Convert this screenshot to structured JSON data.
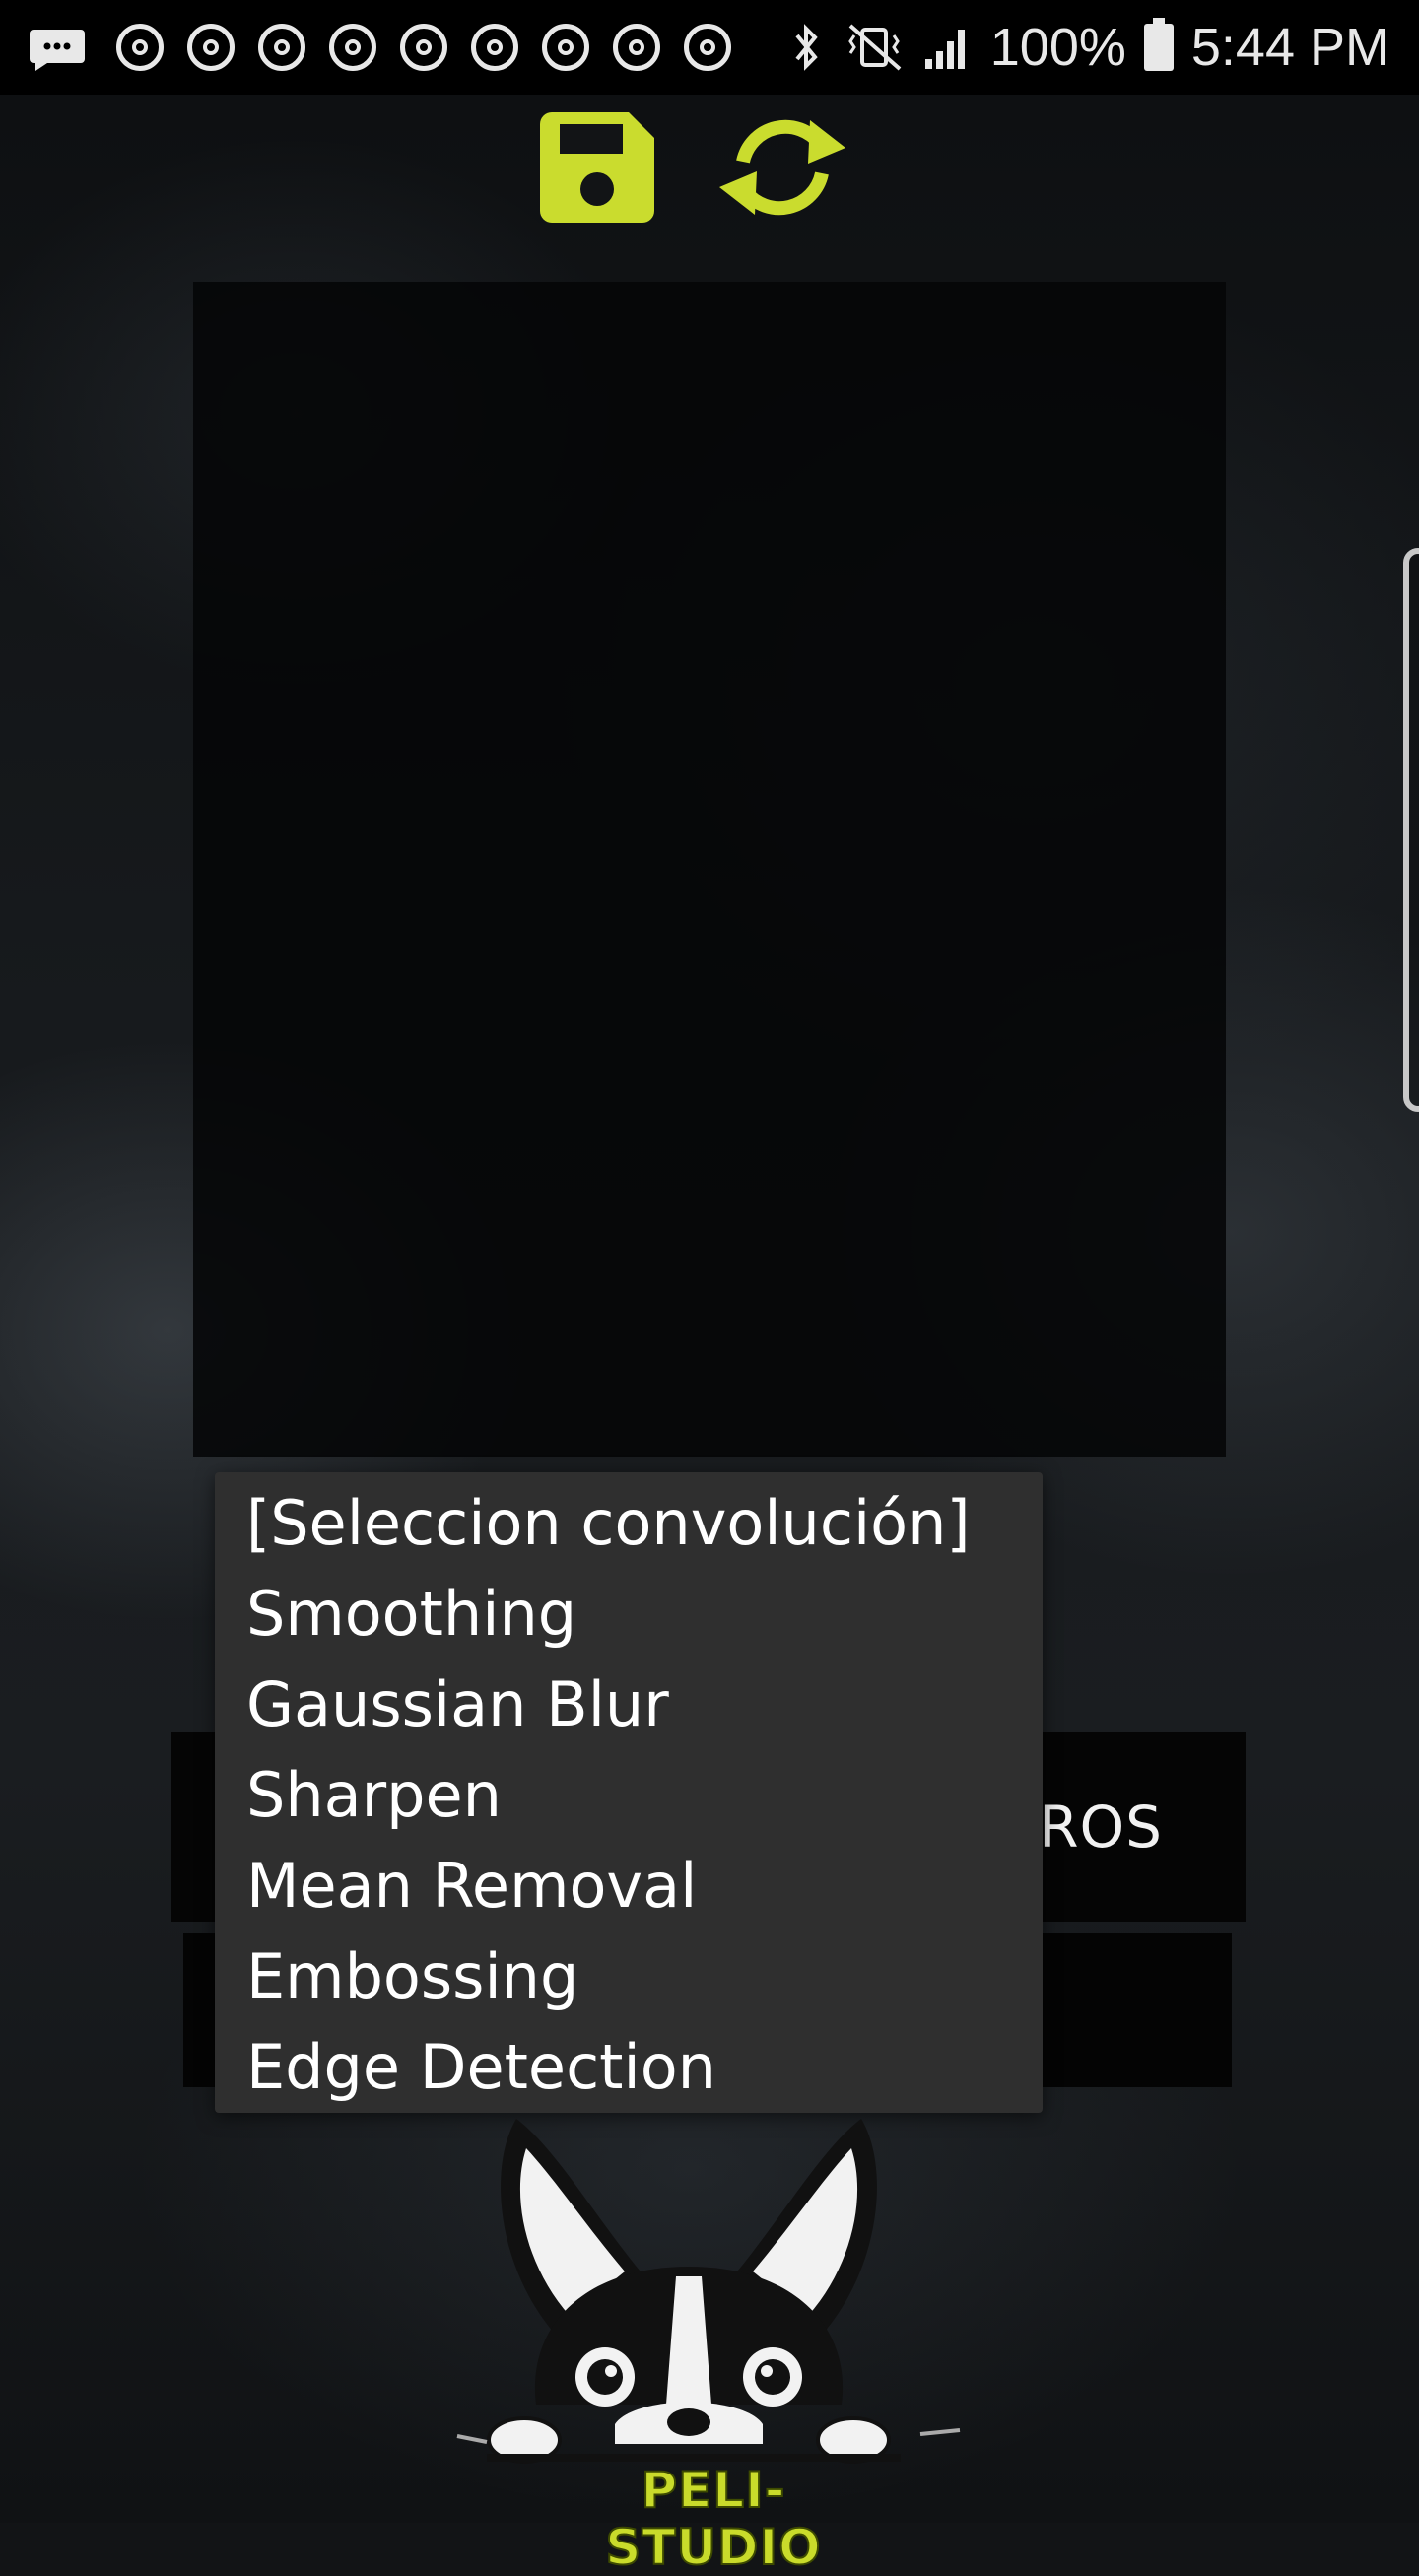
{
  "status_bar": {
    "battery": "100%",
    "time": "5:44 PM",
    "icons": [
      "messages-icon",
      "chrome-icon",
      "chrome-icon",
      "chrome-icon",
      "chrome-icon",
      "chrome-icon",
      "chrome-icon",
      "chrome-icon",
      "chrome-icon",
      "chrome-icon",
      "bluetooth-icon",
      "vibrate-icon",
      "signal-icon",
      "battery-icon"
    ]
  },
  "toolbar": {
    "save_icon": "floppy-save-icon",
    "refresh_icon": "refresh-sync-icon",
    "accent_color": "#cadc2e"
  },
  "main": {
    "filtros_button_label": "TROS"
  },
  "dropdown": {
    "items": [
      "[Seleccion convolución]",
      "Smoothing",
      "Gaussian Blur",
      "Sharpen",
      "Mean Removal",
      "Embossing",
      "Edge Detection"
    ],
    "background": "#2f2f2f"
  },
  "logo": {
    "text": "PELI-STUDIO",
    "text_color": "#c9db2b",
    "icon": "bulldog-logo-icon"
  }
}
